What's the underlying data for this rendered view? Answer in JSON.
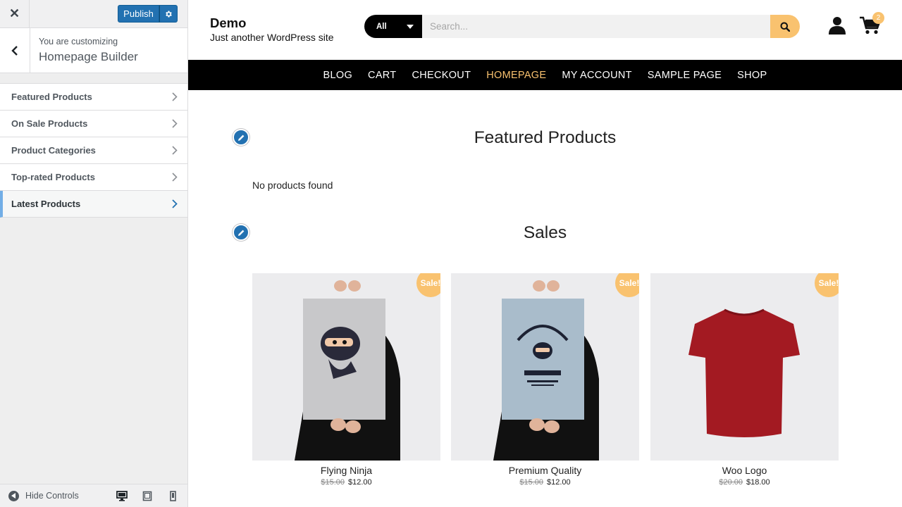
{
  "customizer": {
    "close_icon": "close-icon",
    "publish_label": "Publish",
    "settings_icon": "gear-icon",
    "customizing_label": "You are customizing",
    "section_title": "Homepage Builder",
    "items": [
      {
        "label": "Featured Products"
      },
      {
        "label": "On Sale Products"
      },
      {
        "label": "Product Categories"
      },
      {
        "label": "Top-rated Products"
      },
      {
        "label": "Latest Products"
      }
    ],
    "footer": {
      "hide_controls_label": "Hide Controls",
      "devices": [
        "desktop-icon",
        "tablet-icon",
        "mobile-icon"
      ]
    }
  },
  "site": {
    "title": "Demo",
    "tagline": "Just another WordPress site",
    "search": {
      "category": "All",
      "placeholder": "Search..."
    },
    "cart_count": "2",
    "nav": [
      "BLOG",
      "CART",
      "CHECKOUT",
      "HOMEPAGE",
      "MY ACCOUNT",
      "SAMPLE PAGE",
      "SHOP"
    ],
    "current_nav": "HOMEPAGE"
  },
  "sections": {
    "featured": {
      "title": "Featured Products",
      "empty_text": "No products found"
    },
    "sales": {
      "title": "Sales",
      "badge": "Sale!",
      "products": [
        {
          "name": "Flying Ninja",
          "old_price": "$15.00",
          "price": "$12.00"
        },
        {
          "name": "Premium Quality",
          "old_price": "$15.00",
          "price": "$12.00"
        },
        {
          "name": "Woo Logo",
          "old_price": "$20.00",
          "price": "$18.00"
        }
      ]
    }
  },
  "colors": {
    "accent": "#f9c26f",
    "wp_blue": "#2271b1",
    "nav_bg": "#000000"
  }
}
